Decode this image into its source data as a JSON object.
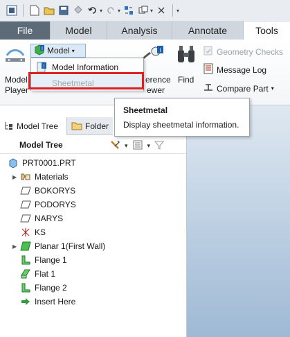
{
  "tabs": [
    {
      "label": "File"
    },
    {
      "label": "Model"
    },
    {
      "label": "Analysis"
    },
    {
      "label": "Annotate"
    },
    {
      "label": "Tools"
    }
  ],
  "ribbon": {
    "model_player_line1": "Model",
    "model_player_line2": "Player",
    "model_dropdown": "Model",
    "reference_viewer_line1": "erence",
    "reference_viewer_line2": "ewer",
    "find": "Find",
    "geometry_checks": "Geometry Checks",
    "message_log": "Message Log",
    "compare_part": "Compare Part"
  },
  "menu": {
    "items": [
      {
        "label": "Model Information"
      },
      {
        "label": "Sheetmetal"
      }
    ]
  },
  "tooltip": {
    "title": "Sheetmetal",
    "body": "Display sheetmetal information."
  },
  "panel": {
    "tabs": [
      {
        "label": "Model Tree"
      },
      {
        "label": "Folder"
      }
    ],
    "tree_title": "Model Tree",
    "items": [
      {
        "label": "PRT0001.PRT"
      },
      {
        "label": "Materials"
      },
      {
        "label": "BOKORYS"
      },
      {
        "label": "PODORYS"
      },
      {
        "label": "NARYS"
      },
      {
        "label": "KS"
      },
      {
        "label": "Planar 1(First Wall)"
      },
      {
        "label": "Flange 1"
      },
      {
        "label": "Flat 1"
      },
      {
        "label": "Flange 2"
      },
      {
        "label": "Insert Here"
      }
    ]
  },
  "colors": {
    "file_tab": "#5d6a78",
    "highlight_box": "#e01f1f",
    "sheetmetal_icon": "#3fae49",
    "info_icon": "#1d5fa8"
  }
}
